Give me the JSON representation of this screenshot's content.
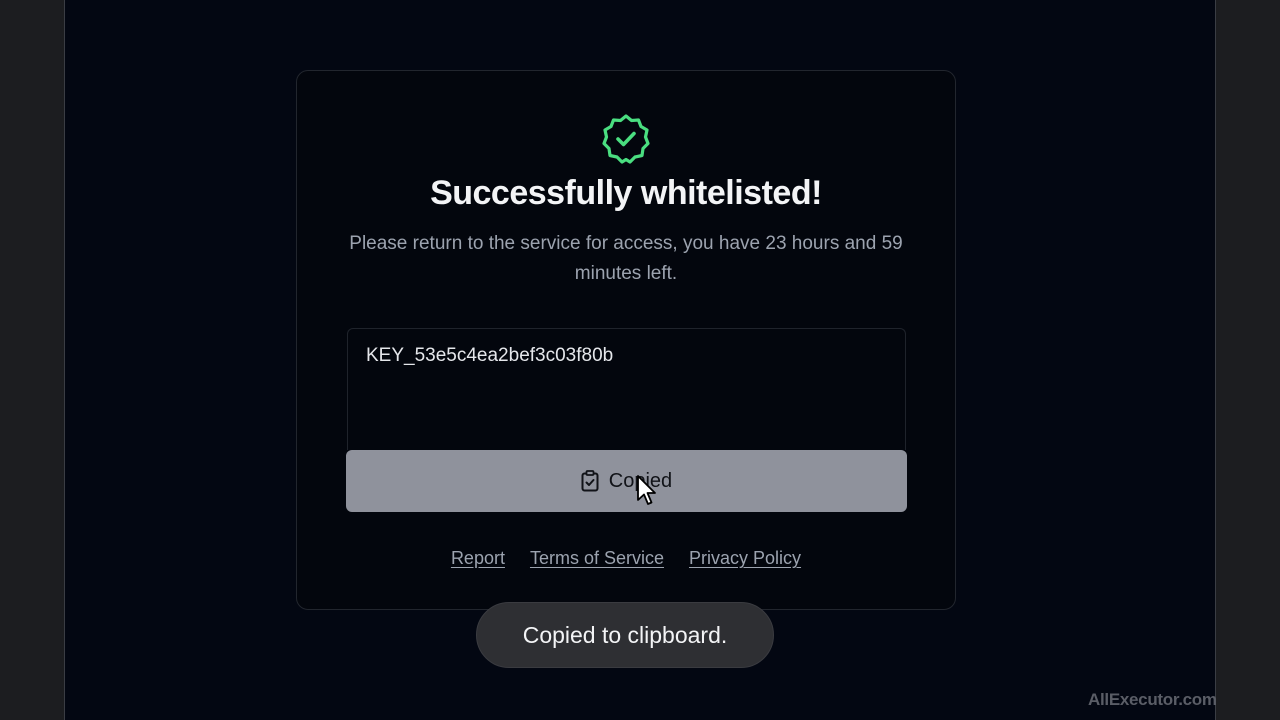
{
  "success": {
    "icon": "verified-badge-icon",
    "title": "Successfully whitelisted!",
    "message": "Please return to the service for access, you have 23 hours and 59 minutes left."
  },
  "key_field": {
    "value": "KEY_53e5c4ea2bef3c03f80b"
  },
  "copy_button": {
    "icon": "clipboard-check-icon",
    "label": "Copied"
  },
  "footer_links": {
    "report": "Report",
    "terms": "Terms of Service",
    "privacy": "Privacy Policy"
  },
  "toast": {
    "message": "Copied to clipboard."
  },
  "watermark": "AllExecutor.com",
  "colors": {
    "background": "#030712",
    "accent_green": "#4ade80",
    "button_bg": "#8f929c",
    "toast_bg": "#2e2f33"
  }
}
